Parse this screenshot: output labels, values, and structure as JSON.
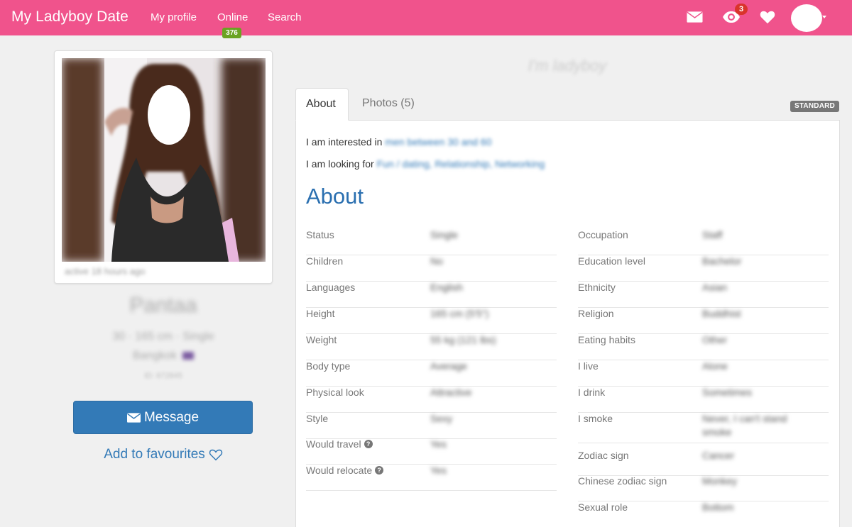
{
  "brand": {
    "name": "My Ladyboy Date"
  },
  "nav": {
    "my_profile": "My profile",
    "online": "Online",
    "online_count": "376",
    "search": "Search",
    "views_count": "3"
  },
  "profile": {
    "active": "active 18 hours ago",
    "name": "Pantaa",
    "meta_line1": "30 · 165 cm · Single",
    "meta_line2": "Bangkok",
    "id_text": "ID: 672845",
    "message_label": "Message",
    "favourites_label": "Add to favourites"
  },
  "tagline": "I'm ladyboy",
  "tabs": {
    "about": "About",
    "photos": "Photos (5)"
  },
  "standard_badge": "STANDARD",
  "interests": {
    "interested_label": "I am interested in",
    "interested_value": "men between 30 and 60",
    "looking_label": "I am looking for",
    "looking_value": "Fun / dating, Relationship, Networking"
  },
  "about_heading": "About",
  "attributes_left": [
    {
      "label": "Status",
      "value": "Single",
      "help": false
    },
    {
      "label": "Children",
      "value": "No",
      "help": false
    },
    {
      "label": "Languages",
      "value": "English",
      "help": false
    },
    {
      "label": "Height",
      "value": "165 cm (5'5\")",
      "help": false
    },
    {
      "label": "Weight",
      "value": "55 kg (121 lbs)",
      "help": false
    },
    {
      "label": "Body type",
      "value": "Average",
      "help": false
    },
    {
      "label": "Physical look",
      "value": "Attractive",
      "help": false
    },
    {
      "label": "Style",
      "value": "Sexy",
      "help": false
    },
    {
      "label": "Would travel",
      "value": "Yes",
      "help": true
    },
    {
      "label": "Would relocate",
      "value": "Yes",
      "help": true
    }
  ],
  "attributes_right": [
    {
      "label": "Occupation",
      "value": "Staff",
      "value2": ""
    },
    {
      "label": "Education level",
      "value": "Bachelor",
      "value2": ""
    },
    {
      "label": "Ethnicity",
      "value": "Asian",
      "value2": ""
    },
    {
      "label": "Religion",
      "value": "Buddhist",
      "value2": ""
    },
    {
      "label": "Eating habits",
      "value": "Other",
      "value2": ""
    },
    {
      "label": "I live",
      "value": "Alone",
      "value2": ""
    },
    {
      "label": "I drink",
      "value": "Sometimes",
      "value2": ""
    },
    {
      "label": "I smoke",
      "value": "Never, I can't stand",
      "value2": "smoke"
    },
    {
      "label": "Zodiac sign",
      "value": "Cancer",
      "value2": ""
    },
    {
      "label": "Chinese zodiac sign",
      "value": "Monkey",
      "value2": ""
    },
    {
      "label": "Sexual role",
      "value": "Bottom",
      "value2": ""
    }
  ]
}
